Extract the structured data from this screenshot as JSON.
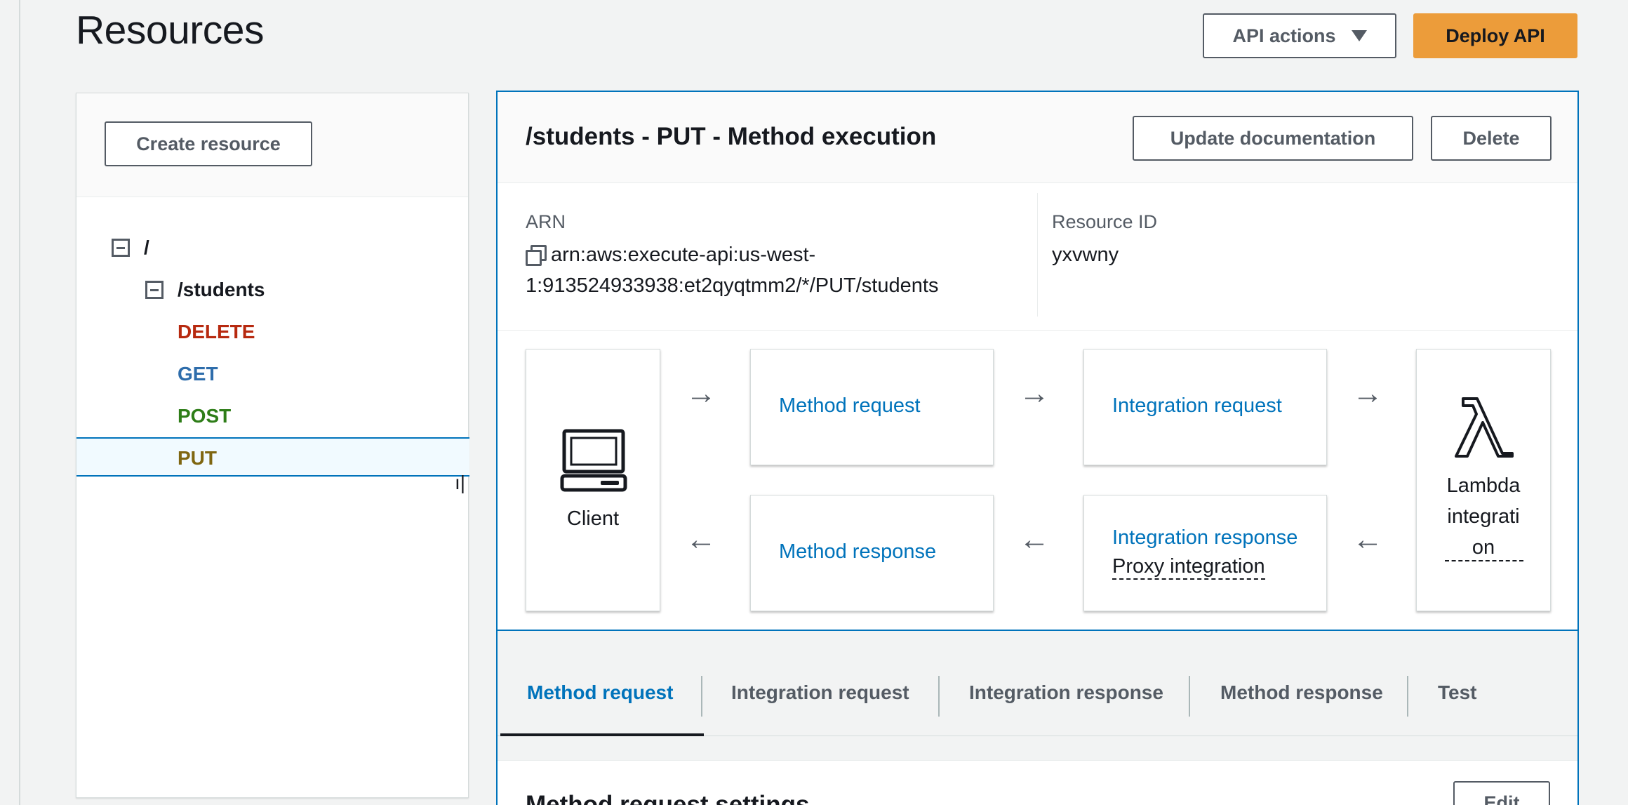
{
  "page": {
    "title": "Resources",
    "api_actions_label": "API actions",
    "deploy_label": "Deploy API"
  },
  "tree": {
    "create_resource_label": "Create resource",
    "root": "/",
    "resource": "/students",
    "methods": [
      {
        "label": "DELETE",
        "color": "#b7290f"
      },
      {
        "label": "GET",
        "color": "#2e6dab"
      },
      {
        "label": "POST",
        "color": "#2e7d18"
      },
      {
        "label": "PUT",
        "color": "#7f6611"
      }
    ],
    "selected": "PUT"
  },
  "detail": {
    "title": "/students - PUT - Method execution",
    "update_doc_label": "Update documentation",
    "delete_label": "Delete",
    "arn_label": "ARN",
    "arn_line1": "arn:aws:execute-api:us-west-",
    "arn_line2": "1:913524933938:et2qyqtmm2/*/PUT/students",
    "resource_id_label": "Resource ID",
    "resource_id_value": "yxvwny"
  },
  "flow": {
    "client_label": "Client",
    "method_request": "Method request",
    "integration_request": "Integration request",
    "method_response": "Method response",
    "integration_response": "Integration response",
    "proxy_integration": "Proxy integration",
    "lambda_line1": "Lambda",
    "lambda_line2": "integrati",
    "lambda_line3": "on"
  },
  "tabs": [
    {
      "label": "Method request",
      "active": true
    },
    {
      "label": "Integration request",
      "active": false
    },
    {
      "label": "Integration response",
      "active": false
    },
    {
      "label": "Method response",
      "active": false
    },
    {
      "label": "Test",
      "active": false
    }
  ],
  "settings": {
    "title": "Method request settings",
    "edit_label": "Edit"
  },
  "colors": {
    "link": "#0073bb",
    "primary": "#ec9c3a",
    "selected_bg": "#f1faff"
  }
}
